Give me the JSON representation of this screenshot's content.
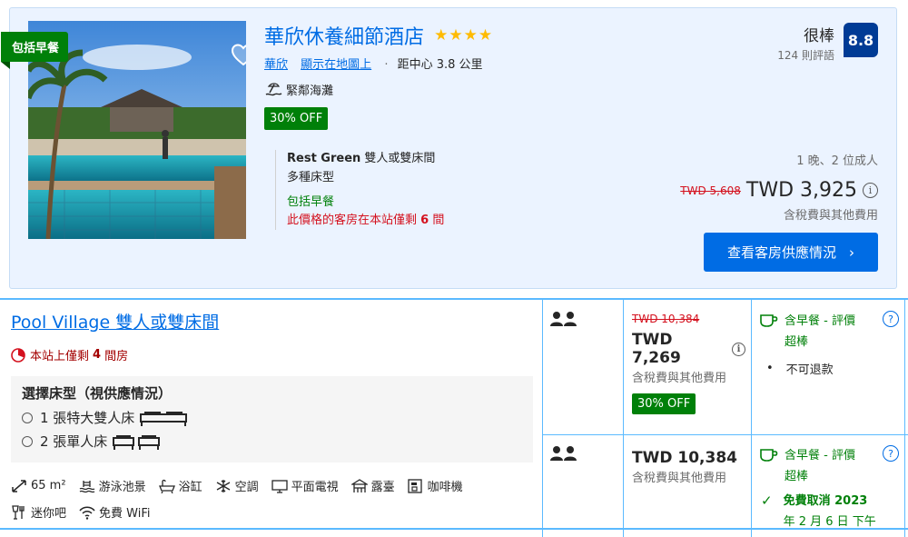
{
  "hotel": {
    "breakfast_ribbon": "包括早餐",
    "name": "華欣休養細節酒店",
    "stars": "★★★★",
    "city_link": "華欣",
    "map_link": "顯示在地圖上",
    "distance": "距中心 3.8 公里",
    "beach": "緊鄰海灘",
    "discount_badge": "30% OFF",
    "room_name_bold": "Rest Green",
    "room_name_rest": "雙人或雙床間",
    "bed_type": "多種床型",
    "breakfast_included": "包括早餐",
    "scarcity_prefix": "此價格的客房在本站僅剩",
    "scarcity_count": "6",
    "scarcity_suffix": "間",
    "rating_word": "很棒",
    "review_count": "124 則評語",
    "score": "8.8",
    "stay": "1 晚、2 位成人",
    "old_price": "TWD 5,608",
    "new_price": "TWD 3,925",
    "tax_note": "含稅費與其他費用",
    "cta_label": "查看客房供應情況",
    "info_icon": "i"
  },
  "room": {
    "name": "Pool Village 雙人或雙床間",
    "left_prefix": "本站上僅剩",
    "left_count": "4",
    "left_suffix": "間房",
    "bed_title": "選擇床型（視供應情況）",
    "bed_options": [
      "1 張特大雙人床",
      "2 張單人床"
    ],
    "facilities": [
      "65 m²",
      "游泳池景",
      "浴缸",
      "空調",
      "平面電視",
      "露臺",
      "咖啡機",
      "迷你吧",
      "免費 WiFi"
    ]
  },
  "offers": [
    {
      "old_price": "TWD 10,384",
      "price": "TWD 7,269",
      "tax_note": "含稅費與其他費用",
      "discount": "30% OFF",
      "meal_line1": "含早餐 - 評價",
      "meal_line2": "超棒",
      "policy": "不可退款",
      "help": "?"
    },
    {
      "price": "TWD 10,384",
      "tax_note": "含稅費與其他費用",
      "meal_line1": "含早餐 - 評價",
      "meal_line2": "超棒",
      "policy_line1": "免費取消 2023",
      "policy_line2": "年 2 月 6 日 下午",
      "help": "?"
    }
  ],
  "colors": {
    "brand_blue": "#006ce4",
    "score_bg": "#003b95",
    "green": "#008009",
    "red": "#d4111e",
    "star": "#febb02"
  }
}
